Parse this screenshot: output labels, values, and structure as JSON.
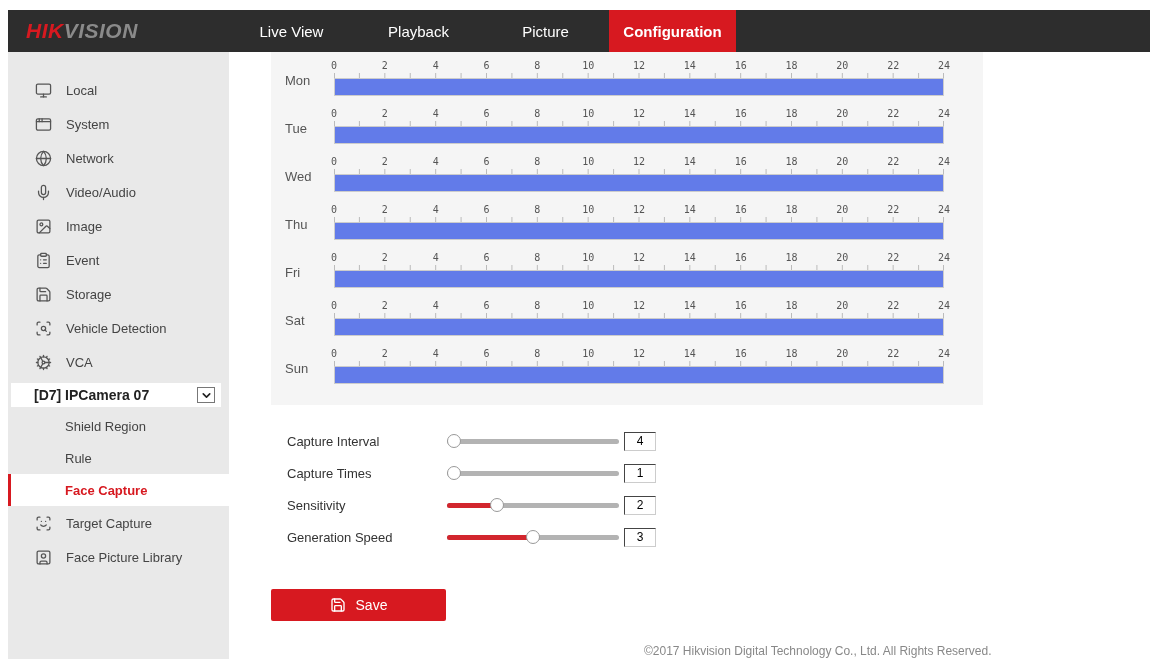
{
  "header": {
    "logo": {
      "part_1": "HIK",
      "part_2": "VISION"
    },
    "tabs": [
      {
        "label": "Live View",
        "selected": false
      },
      {
        "label": "Playback",
        "selected": false
      },
      {
        "label": "Picture",
        "selected": false
      },
      {
        "label": "Configuration",
        "selected": true
      }
    ]
  },
  "sidebar": {
    "items": [
      {
        "label": "Local",
        "selected": false
      },
      {
        "label": "System",
        "selected": false
      },
      {
        "label": "Network",
        "selected": false
      },
      {
        "label": "Video/Audio",
        "selected": false
      },
      {
        "label": "Image",
        "selected": false
      },
      {
        "label": "Event",
        "selected": false
      },
      {
        "label": "Storage",
        "selected": false
      },
      {
        "label": "Vehicle Detection",
        "selected": false
      },
      {
        "label": "VCA",
        "selected": false
      }
    ],
    "channel_select": {
      "value": "[D7] IPCamera 07"
    },
    "sub_items": [
      {
        "label": "Shield Region",
        "selected": false
      },
      {
        "label": "Rule",
        "selected": false
      },
      {
        "label": "Face Capture",
        "selected": true
      }
    ],
    "more_items": [
      {
        "label": "Target Capture",
        "selected": false
      },
      {
        "label": "Face Picture Library",
        "selected": false
      }
    ]
  },
  "schedule": {
    "days": [
      {
        "day": "Mon",
        "scale": [
          "0",
          "2",
          "4",
          "6",
          "8",
          "10",
          "12",
          "14",
          "16",
          "18",
          "20",
          "22",
          "24"
        ]
      },
      {
        "day": "Tue",
        "scale": [
          "0",
          "2",
          "4",
          "6",
          "8",
          "10",
          "12",
          "14",
          "16",
          "18",
          "20",
          "22",
          "24"
        ]
      },
      {
        "day": "Wed",
        "scale": [
          "0",
          "2",
          "4",
          "6",
          "8",
          "10",
          "12",
          "14",
          "16",
          "18",
          "20",
          "22",
          "24"
        ]
      },
      {
        "day": "Thu",
        "scale": [
          "0",
          "2",
          "4",
          "6",
          "8",
          "10",
          "12",
          "14",
          "16",
          "18",
          "20",
          "22",
          "24"
        ]
      },
      {
        "day": "Fri",
        "scale": [
          "0",
          "2",
          "4",
          "6",
          "8",
          "10",
          "12",
          "14",
          "16",
          "18",
          "20",
          "22",
          "24"
        ]
      },
      {
        "day": "Sat",
        "scale": [
          "0",
          "2",
          "4",
          "6",
          "8",
          "10",
          "12",
          "14",
          "16",
          "18",
          "20",
          "22",
          "24"
        ]
      },
      {
        "day": "Sun",
        "scale": [
          "0",
          "2",
          "4",
          "6",
          "8",
          "10",
          "12",
          "14",
          "16",
          "18",
          "20",
          "22",
          "24"
        ]
      }
    ]
  },
  "sliders": [
    {
      "label": "Capture Interval",
      "level": 0,
      "value": "4"
    },
    {
      "label": "Capture Times",
      "level": 0,
      "value": "1"
    },
    {
      "label": "Sensitivity",
      "level": 0.27,
      "value": "2"
    },
    {
      "label": "Generation Speed",
      "level": 0.5,
      "value": "3"
    }
  ],
  "save_button": {
    "label": "Save"
  },
  "footer": {
    "text": "©2017 Hikvision Digital Technology Co., Ltd. All Rights Reserved."
  }
}
